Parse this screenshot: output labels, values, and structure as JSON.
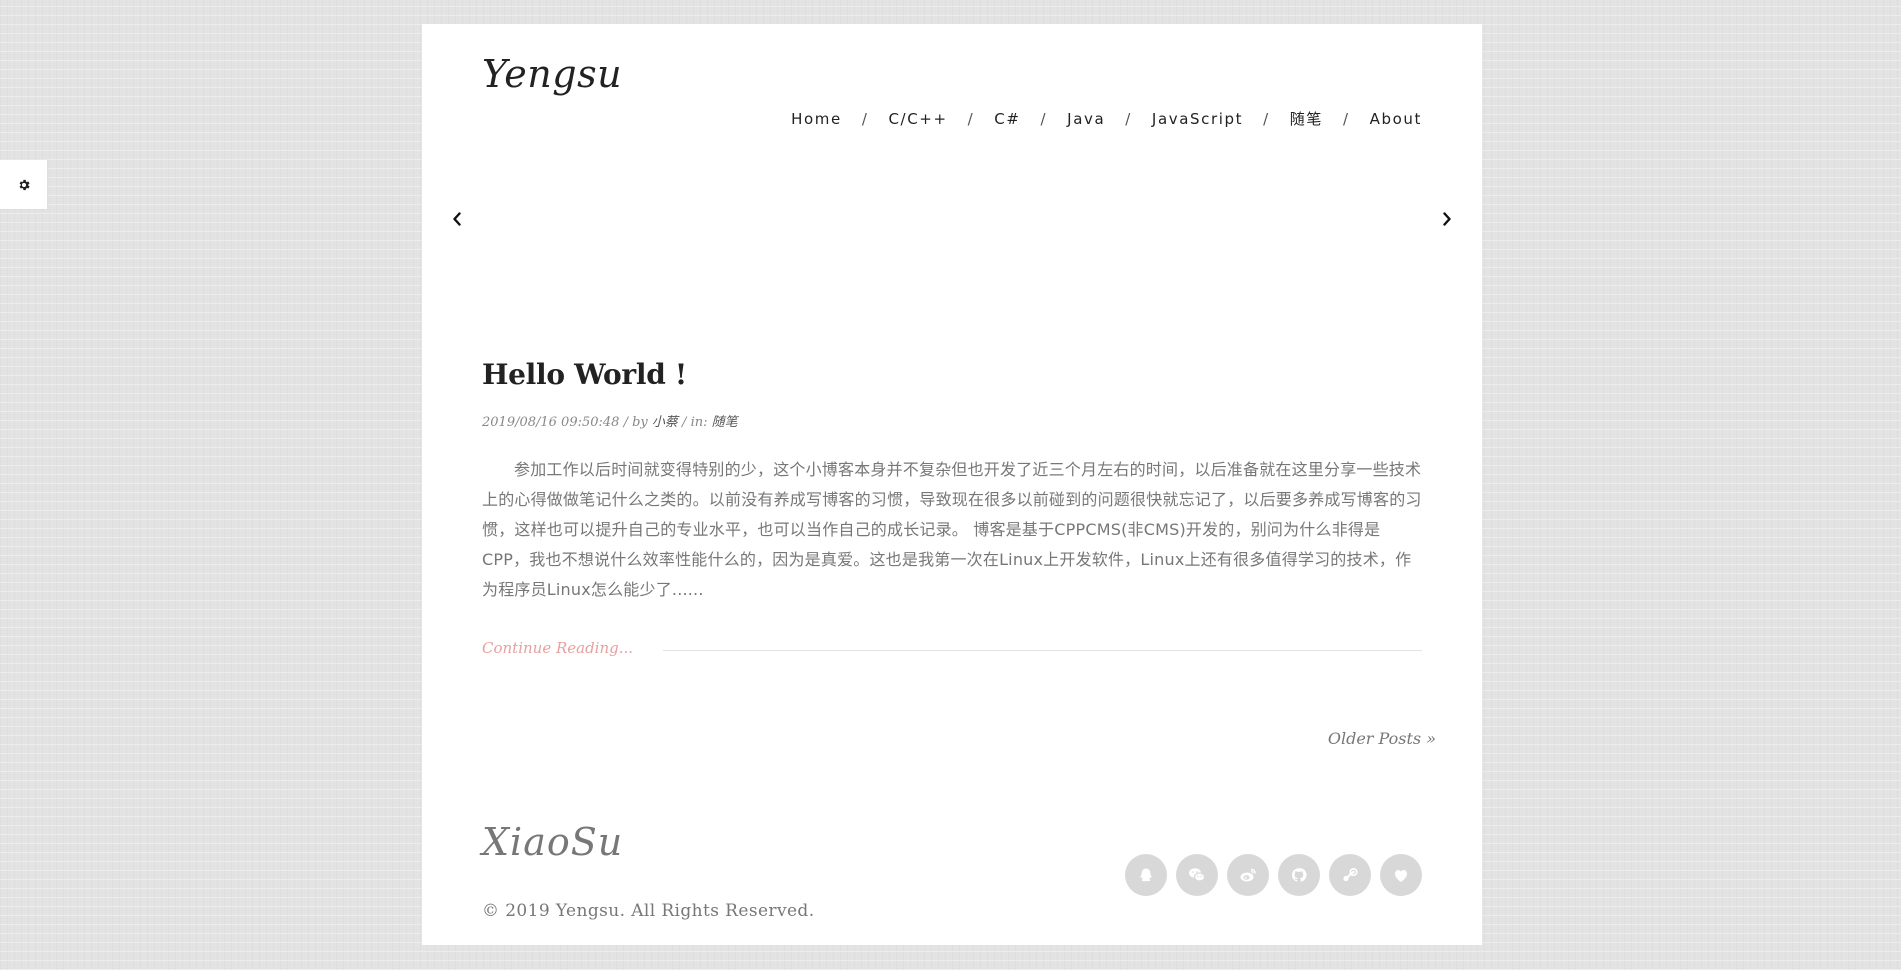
{
  "site": {
    "logo": "Yengsu"
  },
  "nav": {
    "items": [
      {
        "label": "Home"
      },
      {
        "label": "C/C++"
      },
      {
        "label": "C#"
      },
      {
        "label": "Java"
      },
      {
        "label": "JavaScript"
      },
      {
        "label": "随笔"
      },
      {
        "label": "About"
      }
    ],
    "separator": "/"
  },
  "settings": {
    "icon": "gear-icon"
  },
  "slider": {
    "prev_icon": "chevron-left-icon",
    "next_icon": "chevron-right-icon"
  },
  "post": {
    "title": "Hello World !",
    "date": "2019/08/16 09:50:48",
    "by_label": " / by ",
    "author": "小蔡",
    "in_label": " / in: ",
    "category": "随笔",
    "excerpt": "参加工作以后时间就变得特别的少，这个小博客本身并不复杂但也开发了近三个月左右的时间，以后准备就在这里分享一些技术上的心得做做笔记什么之类的。以前没有养成写博客的习惯，导致现在很多以前碰到的问题很快就忘记了，以后要多养成写博客的习惯，这样也可以提升自己的专业水平，也可以当作自己的成长记录。 博客是基于CPPCMS(非CMS)开发的，别问为什么非得是CPP，我也不想说什么效率性能什么的，因为是真爱。这也是我第一次在Linux上开发软件，Linux上还有很多值得学习的技术，作为程序员Linux怎么能少了......",
    "continue_label": "Continue Reading..."
  },
  "pagination": {
    "older_label": "Older Posts »"
  },
  "footer": {
    "logo": "XiaoSu",
    "copyright": "© 2019 Yengsu. All Rights Reserved.",
    "social": [
      {
        "icon": "qq-icon"
      },
      {
        "icon": "wechat-icon"
      },
      {
        "icon": "weibo-icon"
      },
      {
        "icon": "github-icon"
      },
      {
        "icon": "steam-icon"
      },
      {
        "icon": "heart-icon"
      }
    ]
  },
  "colors": {
    "background": "#e3e3e3",
    "page": "#ffffff",
    "accent": "#e8a0a0",
    "text": "#222222",
    "muted": "#777777",
    "social_bg": "#d8d8d8"
  }
}
